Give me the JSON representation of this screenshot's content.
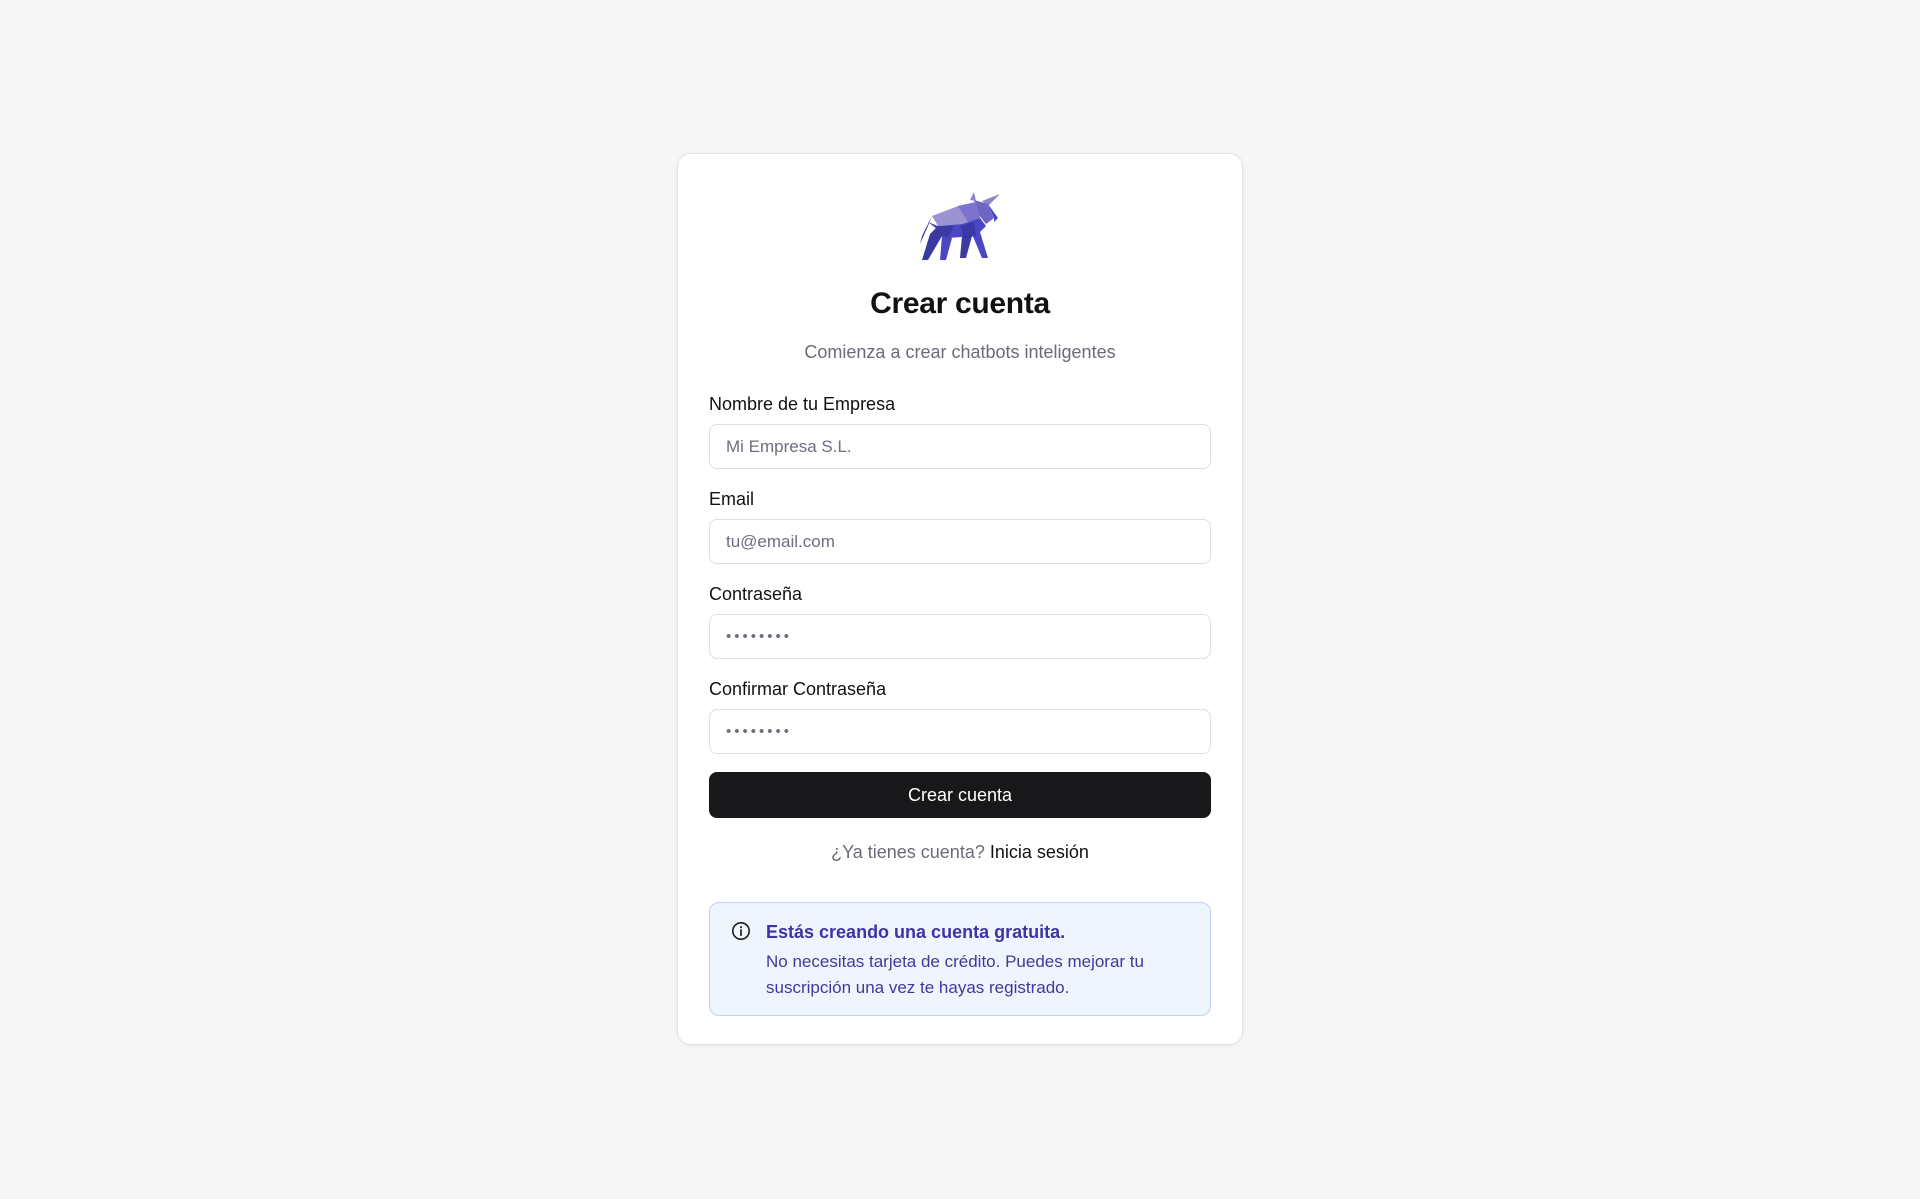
{
  "brand": {
    "logo_icon": "bull-logo-icon",
    "colors": {
      "logo_dark": "#3a3aa0",
      "logo_mid": "#4b47c4",
      "logo_light": "#8d84c9",
      "primary_button": "#18181b",
      "notice_bg": "#eff5fd",
      "notice_text": "#3b34a6"
    }
  },
  "header": {
    "title": "Crear cuenta",
    "subtitle": "Comienza a crear chatbots inteligentes"
  },
  "form": {
    "company": {
      "label": "Nombre de tu Empresa",
      "placeholder": "Mi Empresa S.L.",
      "value": ""
    },
    "email": {
      "label": "Email",
      "placeholder": "tu@email.com",
      "value": ""
    },
    "password": {
      "label": "Contraseña",
      "placeholder": "••••••••",
      "value": ""
    },
    "confirm_password": {
      "label": "Confirmar Contraseña",
      "placeholder": "••••••••",
      "value": ""
    },
    "submit_label": "Crear cuenta"
  },
  "login": {
    "prompt": "¿Ya tienes cuenta?",
    "link_label": "Inicia sesión"
  },
  "notice": {
    "icon": "info-icon",
    "title": "Estás creando una cuenta gratuita.",
    "text": "No necesitas tarjeta de crédito. Puedes mejorar tu suscripción una vez te hayas registrado."
  }
}
